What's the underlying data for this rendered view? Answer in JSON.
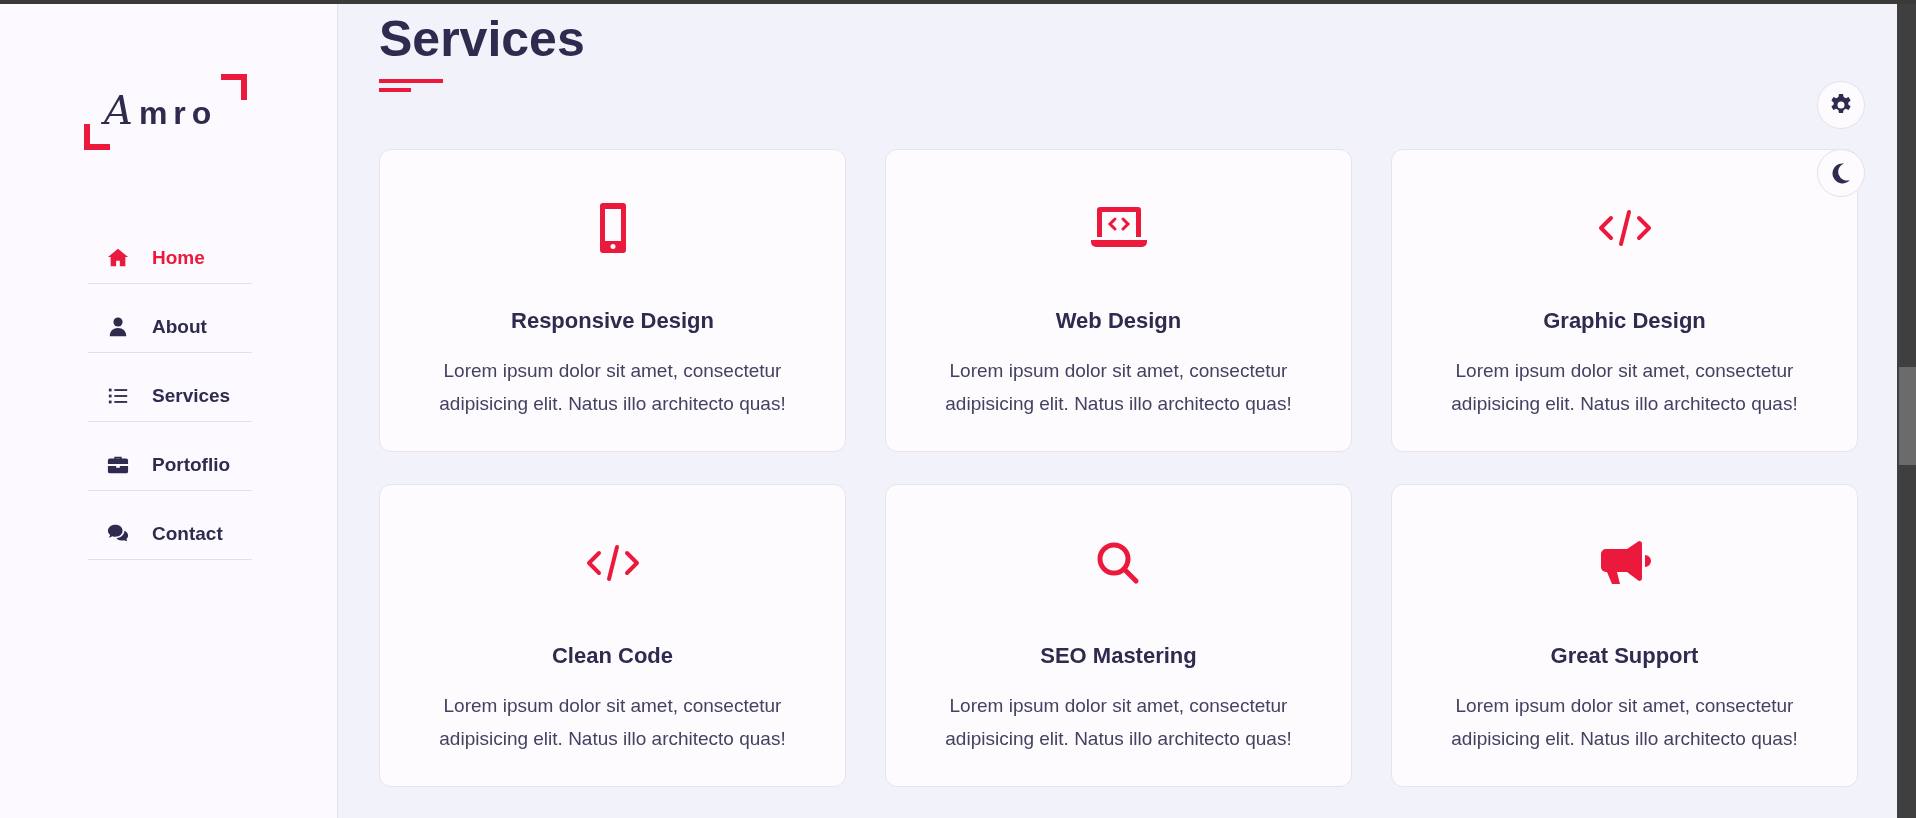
{
  "logo": "Amro",
  "nav": [
    {
      "label": "Home",
      "selected": true
    },
    {
      "label": "About",
      "selected": false
    },
    {
      "label": "Services",
      "selected": false
    },
    {
      "label": "Portoflio",
      "selected": false
    },
    {
      "label": "Contact",
      "selected": false
    }
  ],
  "heading": "Services",
  "services": [
    {
      "title": "Responsive Design",
      "text": "Lorem ipsum dolor sit amet, consectetur adipisicing elit. Natus illo architecto quas!"
    },
    {
      "title": "Web Design",
      "text": "Lorem ipsum dolor sit amet, consectetur adipisicing elit. Natus illo architecto quas!"
    },
    {
      "title": "Graphic Design",
      "text": "Lorem ipsum dolor sit amet, consectetur adipisicing elit. Natus illo architecto quas!"
    },
    {
      "title": "Clean Code",
      "text": "Lorem ipsum dolor sit amet, consectetur adipisicing elit. Natus illo architecto quas!"
    },
    {
      "title": "SEO Mastering",
      "text": "Lorem ipsum dolor sit amet, consectetur adipisicing elit. Natus illo architecto quas!"
    },
    {
      "title": "Great Support",
      "text": "Lorem ipsum dolor sit amet, consectetur adipisicing elit. Natus illo architecto quas!"
    }
  ]
}
